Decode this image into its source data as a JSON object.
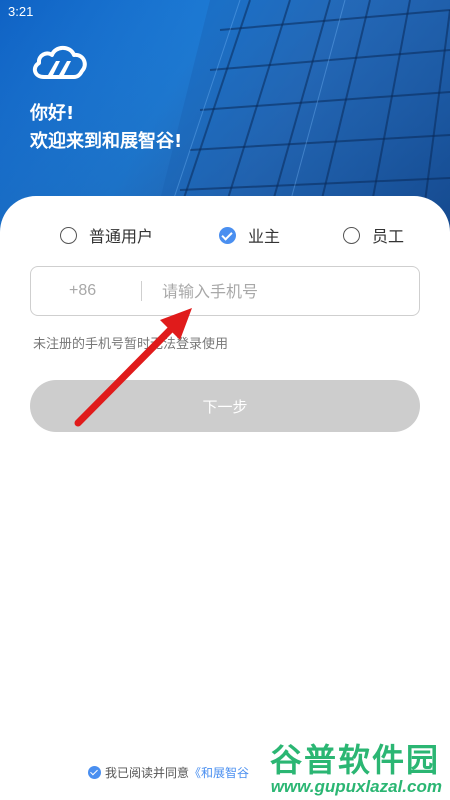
{
  "status_bar": {
    "time": "3:21"
  },
  "header": {
    "greeting_line1": "你好!",
    "greeting_line2": "欢迎来到和展智谷!"
  },
  "roles": [
    {
      "label": "普通用户",
      "checked": false
    },
    {
      "label": "业主",
      "checked": true
    },
    {
      "label": "员工",
      "checked": false
    }
  ],
  "phone": {
    "country_code": "+86",
    "placeholder": "请输入手机号",
    "value": ""
  },
  "hint": "未注册的手机号暂时无法登录使用",
  "next_button": "下一步",
  "agreement": {
    "text": "我已阅读并同意",
    "link": "《和展智谷"
  },
  "watermark": {
    "title": "谷普软件园",
    "url": "www.gupuxlazal.com"
  },
  "colors": {
    "accent": "#4a8ff0",
    "button_disabled": "#cdcdcd",
    "annotation_arrow": "#e01b1b",
    "watermark": "#2bb673"
  }
}
